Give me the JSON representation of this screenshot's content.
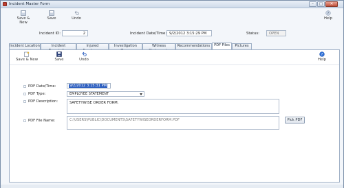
{
  "window": {
    "title": "Incident Master Form",
    "min": "–",
    "max": "□",
    "close": "✕"
  },
  "toolbar": {
    "save_new": "Save & New",
    "save": "Save",
    "undo": "Undo",
    "help": "Help"
  },
  "header": {
    "incident_id_label": "Incident ID:",
    "incident_id_value": "2",
    "incident_datetime_label": "Incident Date/Time:",
    "incident_datetime_value": "9/2/2012 3:15:29 PM",
    "status_label": "Status:",
    "status_value": "OPEN"
  },
  "tabs": [
    "Incident Location",
    "Incident Description",
    "Injured Employees",
    "Investigation Team",
    "Witness Statements",
    "Recommendations",
    "PDF Files",
    "Pictures"
  ],
  "active_tab_index": 6,
  "panel_toolbar": {
    "save_new": "Save & New",
    "save": "Save",
    "undo": "Undo",
    "help": "Help"
  },
  "form": {
    "pdf_datetime_label": "PDF Date/Time:",
    "pdf_datetime_value": "9/2/2012 3:15:31 PM",
    "pdf_type_label": "PDF Type:",
    "pdf_type_value": "EMPLOYEE STATEMENT",
    "pdf_description_label": "PDF Description:",
    "pdf_description_value": "SAFETYWISE ORDER FORM.",
    "pdf_filename_label": "PDF File Name:",
    "pdf_filename_value": "C:\\USERS\\PUBLIC\\DOCUMENTS\\SAFETYWISEORDERFORM.PDF",
    "pick_pdf_button": "Pick PDF"
  },
  "icons": {
    "save_new": "save-new-icon",
    "save": "floppy-disk-icon",
    "undo": "undo-arrow-icon",
    "help": "help-circle-icon"
  },
  "colors": {
    "accent_blue": "#2b5fc0",
    "help_blue": "#2e6fd6",
    "save_navy": "#2a3f7a"
  }
}
